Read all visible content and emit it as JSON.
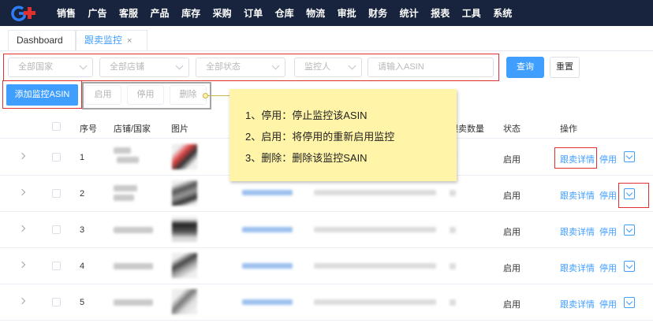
{
  "nav": {
    "items": [
      "销售",
      "广告",
      "客服",
      "产品",
      "库存",
      "采购",
      "订单",
      "仓库",
      "物流",
      "审批",
      "财务",
      "统计",
      "报表",
      "工具",
      "系统"
    ]
  },
  "tabs": {
    "dashboard": "Dashboard",
    "active": "跟卖监控",
    "close": "×"
  },
  "filters": {
    "country": "全部国家",
    "shop": "全部店铺",
    "status": "全部状态",
    "monitor": "监控人",
    "asin_placeholder": "请输入ASIN",
    "query": "查询",
    "reset": "重置"
  },
  "actions": {
    "add": "添加监控ASIN",
    "enable": "启用",
    "disable": "停用",
    "delete": "删除"
  },
  "callout": {
    "lines": [
      "1、停用：停止监控该ASIN",
      "2、启用：将停用的重新启用监控",
      "3、删除：删除该监控SAIN"
    ]
  },
  "table": {
    "headers": {
      "index": "序号",
      "shop": "店铺/国家",
      "image": "图片",
      "count": "跟卖数量",
      "status": "状态",
      "ops": "操作"
    },
    "rows": [
      {
        "index": "1",
        "status": "启用",
        "detail": "跟卖详情",
        "disable": "停用"
      },
      {
        "index": "2",
        "status": "启用",
        "detail": "跟卖详情",
        "disable": "停用"
      },
      {
        "index": "3",
        "status": "启用",
        "detail": "跟卖详情",
        "disable": "停用"
      },
      {
        "index": "4",
        "status": "启用",
        "detail": "跟卖详情",
        "disable": "停用"
      },
      {
        "index": "5",
        "status": "启用",
        "detail": "跟卖详情",
        "disable": "停用"
      }
    ]
  },
  "colors": {
    "nav_bg": "#18243d",
    "primary": "#409eff",
    "highlight_red": "#e0302f",
    "callout_bg": "#fff4a8"
  }
}
